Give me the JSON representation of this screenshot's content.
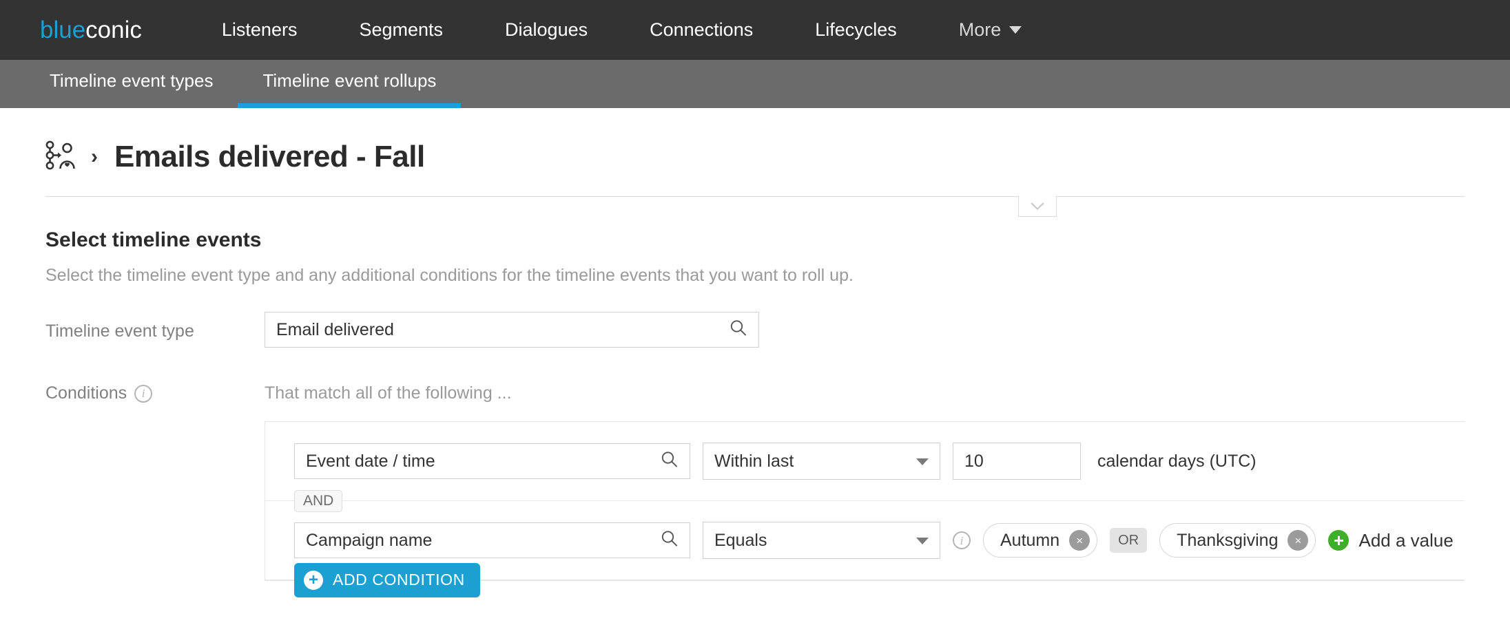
{
  "brand": {
    "first": "blue",
    "second": "conic"
  },
  "topnav": {
    "items": [
      {
        "label": "Listeners"
      },
      {
        "label": "Segments"
      },
      {
        "label": "Dialogues"
      },
      {
        "label": "Connections"
      },
      {
        "label": "Lifecycles"
      },
      {
        "label": "More"
      }
    ]
  },
  "subnav": {
    "tabs": [
      {
        "label": "Timeline event types",
        "active": false
      },
      {
        "label": "Timeline event rollups",
        "active": true
      }
    ]
  },
  "header": {
    "breadcrumb_icon": "profile-rollup-icon",
    "separator": "›",
    "title": "Emails delivered - Fall"
  },
  "section": {
    "title": "Select timeline events",
    "description": "Select the timeline event type and any additional conditions for the timeline events that you want to roll up."
  },
  "form": {
    "event_type": {
      "label": "Timeline event type",
      "value": "Email delivered",
      "icon": "search-icon"
    },
    "conditions": {
      "label": "Conditions",
      "info_icon": "i",
      "match_text": "That match all of the following ...",
      "separator_label": "AND",
      "rows": [
        {
          "field": "Event date / time",
          "field_icon": "search-icon",
          "operator": "Within last",
          "value": "10",
          "unit": "calendar days (UTC)"
        },
        {
          "field": "Campaign name",
          "field_icon": "search-icon",
          "operator": "Equals",
          "info_icon": "i",
          "values": [
            {
              "label": "Autumn",
              "remove": "×"
            },
            {
              "label": "Thanksgiving",
              "remove": "×"
            }
          ],
          "value_joiner": "OR",
          "add_value_label": "Add a value",
          "add_value_icon": "plus-icon"
        }
      ],
      "add_condition_label": "ADD CONDITION",
      "add_condition_icon": "plus-icon"
    }
  },
  "colors": {
    "brand_blue": "#1ba0d1",
    "topnav_bg": "#333333",
    "subnav_bg": "#6b6b6b",
    "green": "#3fae2a"
  }
}
